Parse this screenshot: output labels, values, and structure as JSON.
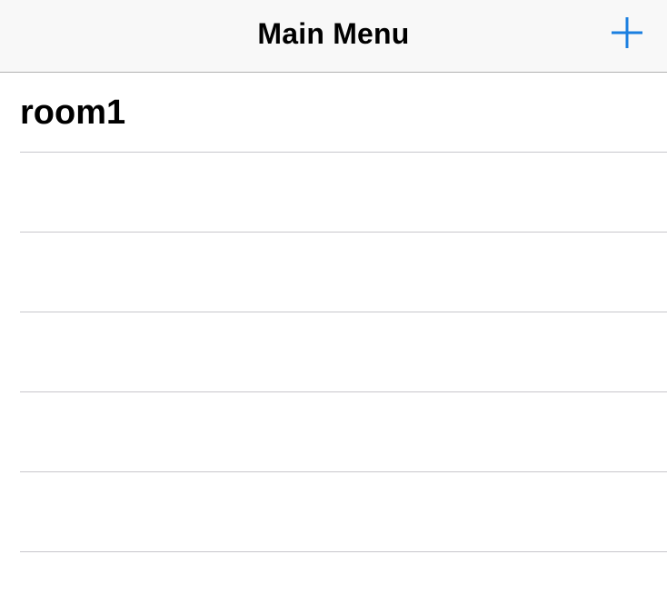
{
  "nav": {
    "title": "Main Menu",
    "add_icon": "plus-icon",
    "accent_color": "#1a7fe0"
  },
  "rooms": {
    "items": [
      {
        "label": "room1"
      },
      {
        "label": ""
      },
      {
        "label": ""
      },
      {
        "label": ""
      },
      {
        "label": ""
      },
      {
        "label": ""
      }
    ]
  }
}
